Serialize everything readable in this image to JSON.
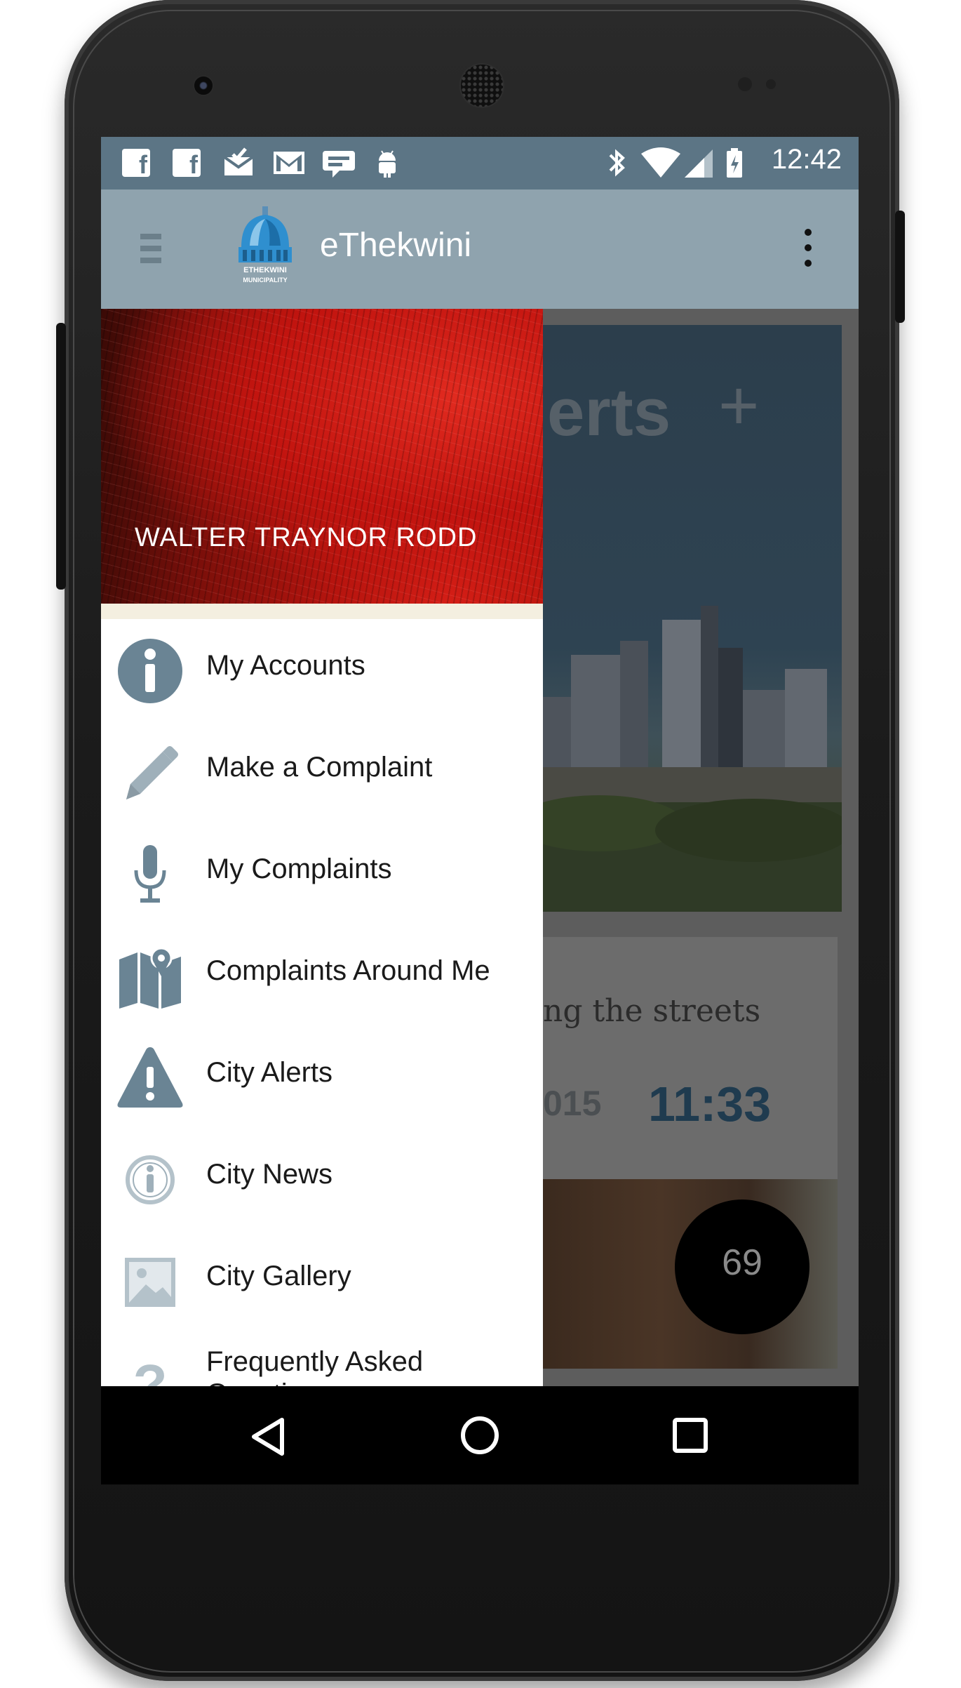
{
  "status_bar": {
    "time": "12:42",
    "notification_icons": [
      "facebook-icon",
      "facebook-icon",
      "inbox-icon",
      "gmail-icon",
      "hangouts-icon",
      "android-icon"
    ],
    "system_icons": [
      "bluetooth-icon",
      "wifi-icon",
      "signal-icon",
      "battery-charging-icon"
    ]
  },
  "toolbar": {
    "title": "eThekwini",
    "logo_text": "ETHEKWINI MUNICIPALITY",
    "menu_icon": "hamburger-icon",
    "overflow_icon": "more-vert-icon"
  },
  "drawer": {
    "user_name": "WALTER TRAYNOR RODD",
    "items": [
      {
        "label": "My Accounts",
        "icon": "info-circle-icon"
      },
      {
        "label": "Make a Complaint",
        "icon": "pencil-icon"
      },
      {
        "label": "My Complaints",
        "icon": "microphone-icon"
      },
      {
        "label": "Complaints Around Me",
        "icon": "map-pin-icon"
      },
      {
        "label": "City Alerts",
        "icon": "warning-icon"
      },
      {
        "label": "City News",
        "icon": "info-outline-icon"
      },
      {
        "label": "City Gallery",
        "icon": "image-icon"
      },
      {
        "label": "Frequently Asked Questions",
        "icon": "question-icon"
      }
    ]
  },
  "background": {
    "hero_title": "Alerts",
    "card_text": "ng the streets",
    "card_year": "015",
    "card_time": "11:33",
    "badge_count": "69"
  },
  "colors": {
    "status_bar": "#5c7585",
    "toolbar": "#8fa3ae",
    "icon": "#6a8494",
    "accent_time": "#1f3b4f"
  }
}
